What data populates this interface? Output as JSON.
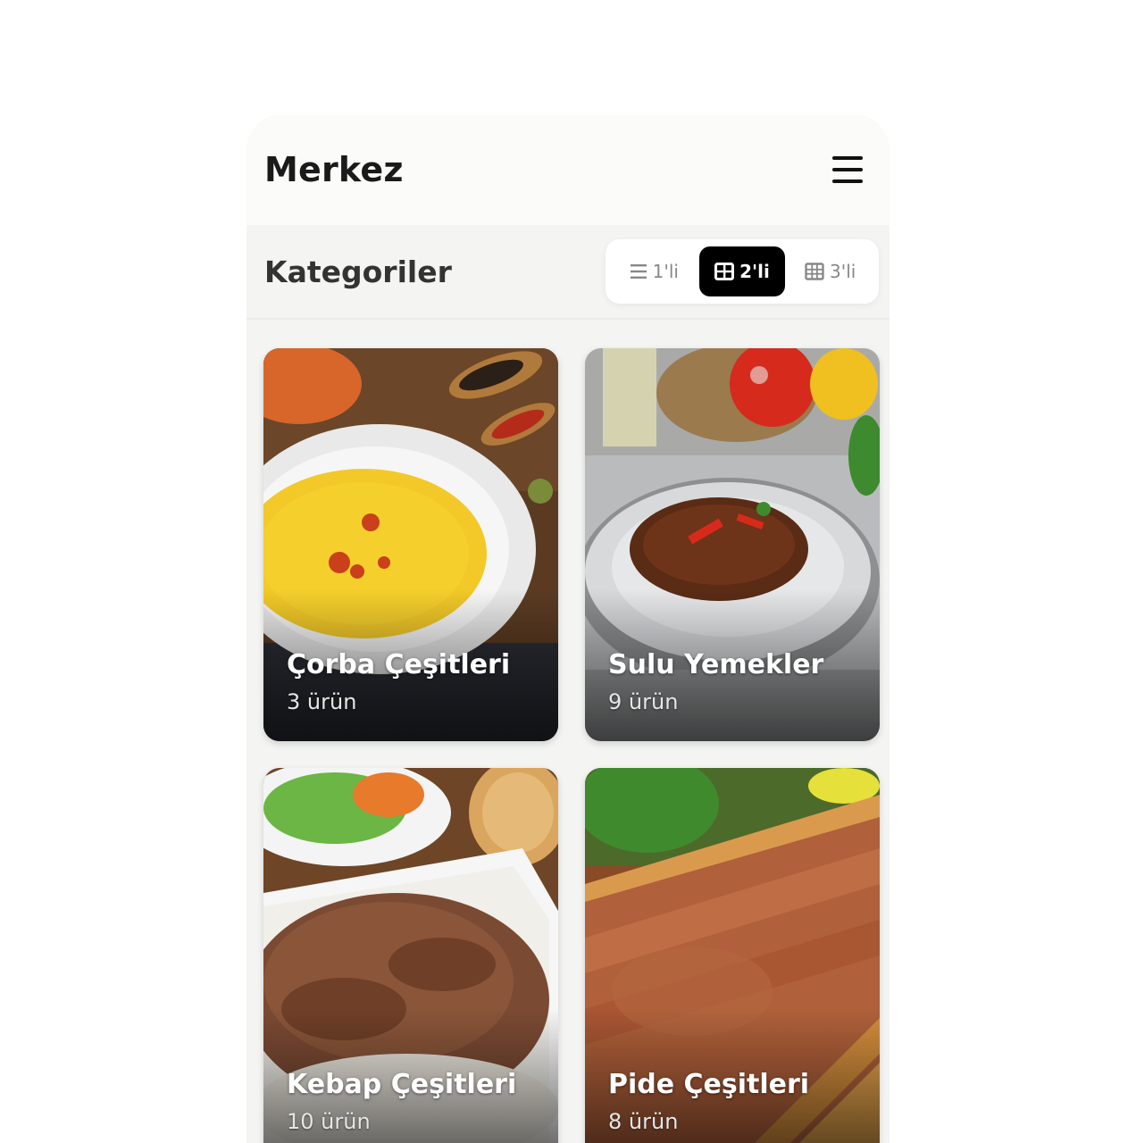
{
  "header": {
    "title": "Merkez",
    "menu_icon": "hamburger-menu-icon"
  },
  "toolbar": {
    "section_title": "Kategoriler",
    "view_options": [
      {
        "label": "1'li",
        "icon": "list-icon",
        "active": false
      },
      {
        "label": "2'li",
        "icon": "grid-2-icon",
        "active": true
      },
      {
        "label": "3'li",
        "icon": "grid-3-icon",
        "active": false
      }
    ]
  },
  "categories": [
    {
      "name": "Çorba Çeşitleri",
      "count": "3 ürün"
    },
    {
      "name": "Sulu Yemekler",
      "count": "9 ürün"
    },
    {
      "name": "Kebap Çeşitleri",
      "count": "10 ürün"
    },
    {
      "name": "Pide Çeşitleri",
      "count": "8 ürün"
    }
  ],
  "colors": {
    "active_segment": "#000000",
    "background": "#f4f4f2",
    "header": "#fbfbfa"
  }
}
